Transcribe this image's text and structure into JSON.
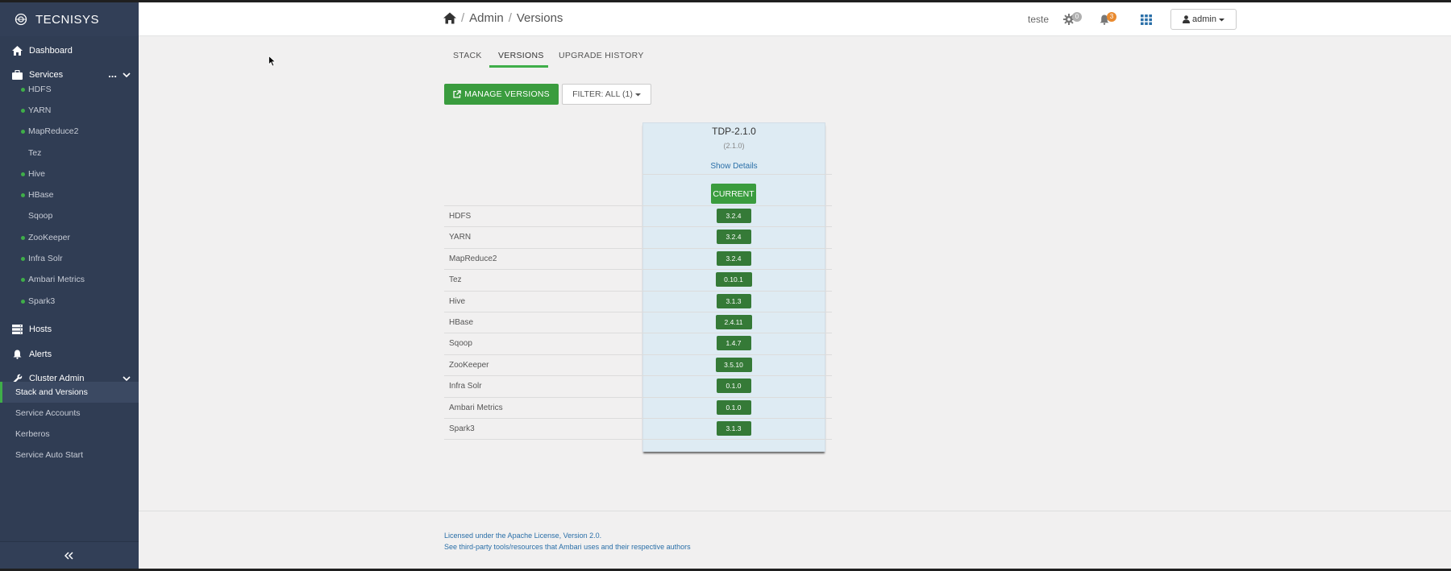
{
  "brand": {
    "name": "TECNISYS"
  },
  "sidebar": {
    "dashboard": "Dashboard",
    "services": "Services",
    "services_menu": "...",
    "service_items": [
      {
        "label": "HDFS",
        "status": "green"
      },
      {
        "label": "YARN",
        "status": "green"
      },
      {
        "label": "MapReduce2",
        "status": "green"
      },
      {
        "label": "Tez",
        "status": "none"
      },
      {
        "label": "Hive",
        "status": "green"
      },
      {
        "label": "HBase",
        "status": "green"
      },
      {
        "label": "Sqoop",
        "status": "none"
      },
      {
        "label": "ZooKeeper",
        "status": "green"
      },
      {
        "label": "Infra Solr",
        "status": "green"
      },
      {
        "label": "Ambari Metrics",
        "status": "green"
      },
      {
        "label": "Spark3",
        "status": "green"
      }
    ],
    "hosts": "Hosts",
    "alerts": "Alerts",
    "cluster_admin": "Cluster Admin",
    "cluster_admin_items": [
      "Stack and Versions",
      "Service Accounts",
      "Kerberos",
      "Service Auto Start"
    ],
    "active_item": "Stack and Versions"
  },
  "header": {
    "breadcrumb": [
      "Admin",
      "Versions"
    ],
    "cluster_name": "teste",
    "ops_count": "0",
    "alerts_count": "3",
    "user": "admin"
  },
  "tabs": [
    "STACK",
    "VERSIONS",
    "UPGRADE HISTORY"
  ],
  "active_tab": "VERSIONS",
  "actions": {
    "manage_versions": "MANAGE VERSIONS",
    "filter": "FILTER: ALL (1)"
  },
  "version": {
    "name": "TDP-2.1.0",
    "sub": "(2.1.0)",
    "show_details": "Show Details",
    "status": "CURRENT"
  },
  "components": [
    {
      "name": "HDFS",
      "version": "3.2.4"
    },
    {
      "name": "YARN",
      "version": "3.2.4"
    },
    {
      "name": "MapReduce2",
      "version": "3.2.4"
    },
    {
      "name": "Tez",
      "version": "0.10.1"
    },
    {
      "name": "Hive",
      "version": "3.1.3"
    },
    {
      "name": "HBase",
      "version": "2.4.11"
    },
    {
      "name": "Sqoop",
      "version": "1.4.7"
    },
    {
      "name": "ZooKeeper",
      "version": "3.5.10"
    },
    {
      "name": "Infra Solr",
      "version": "0.1.0"
    },
    {
      "name": "Ambari Metrics",
      "version": "0.1.0"
    },
    {
      "name": "Spark3",
      "version": "3.1.3"
    }
  ],
  "footer": {
    "license": "Licensed under the Apache License, Version 2.0.",
    "third_party": "See third-party tools/resources that Ambari uses and their respective authors"
  },
  "colors": {
    "sidebar_bg": "#303d54",
    "accent_green": "#3a9c3e",
    "badge_dark_green": "#357a37",
    "ops_badge": "#b0b0b0",
    "alert_badge": "#e98a2f",
    "link_blue": "#2a6fa8"
  }
}
